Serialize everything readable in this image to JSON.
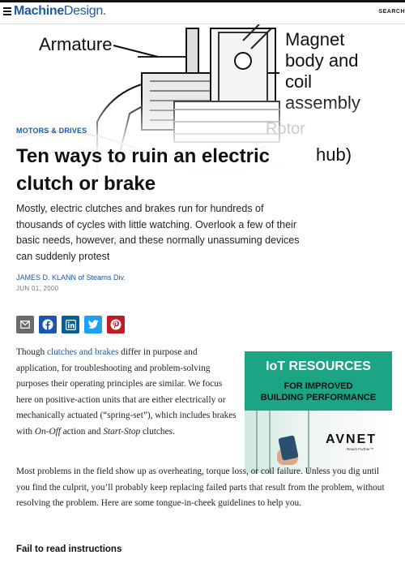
{
  "header": {
    "logo_bold": "Machine",
    "logo_rest": "Design.",
    "search_label": "SEARCH"
  },
  "hero": {
    "label_armature": "Armature",
    "label_magnet": "Magnet\nbody and\ncoil\nassembly",
    "label_rotor": "Rotor",
    "label_hub": "hub)"
  },
  "article": {
    "section": "MOTORS & DRIVES",
    "title": "Ten ways to ruin an electric clutch or brake",
    "dek": "Mostly, electric clutches and brakes run for hundreds of thousands of cycles with little watching. Overlook a few of their basic needs, however, and these normally unassuming devices can suddenly protest",
    "author": "JAMES D. KLANN of Stearns Div.",
    "date": "JUN 01, 2000"
  },
  "share_icons": [
    "email-icon",
    "facebook-icon",
    "linkedin-icon",
    "twitter-icon",
    "pinterest-icon"
  ],
  "colors": {
    "accent": "#1b5aa6",
    "email": "#6b6b6b",
    "facebook": "#1a56b2",
    "linkedin": "#0a5f95",
    "twitter": "#1da1f2",
    "pinterest": "#c41a24",
    "ad_green": "#1ba584"
  },
  "body": {
    "p1_before_link": "Though ",
    "p1_link": "clutches and brakes",
    "p1_mid": " differ in purpose and application, for troubleshooting and problem-solving purposes their operating principles are similar. We focus here on positive-action units that are either electrically or mechanically actuated (“spring-set”), which includes brakes with ",
    "p1_onoff": "On-Off",
    "p1_and": " action and ",
    "p1_startstop": "Start-Stop",
    "p1_end": " clutches.",
    "p2": "Most problems in the field show up as overheating, torque loss, or coil failure. Unless you dig until you find the culprit, you’ll probably keep replacing failed parts that result from the problem, without resolving the problem. Here are some tongue-in-cheek guidelines to help you.",
    "subhead": "Fail to read instructions"
  },
  "ad": {
    "headline": "IoT RESOURCES",
    "subline1": "FOR IMPROVED",
    "subline2": "BUILDING PERFORMANCE",
    "brand": "AVNET",
    "tagline": "Reach Further™"
  }
}
